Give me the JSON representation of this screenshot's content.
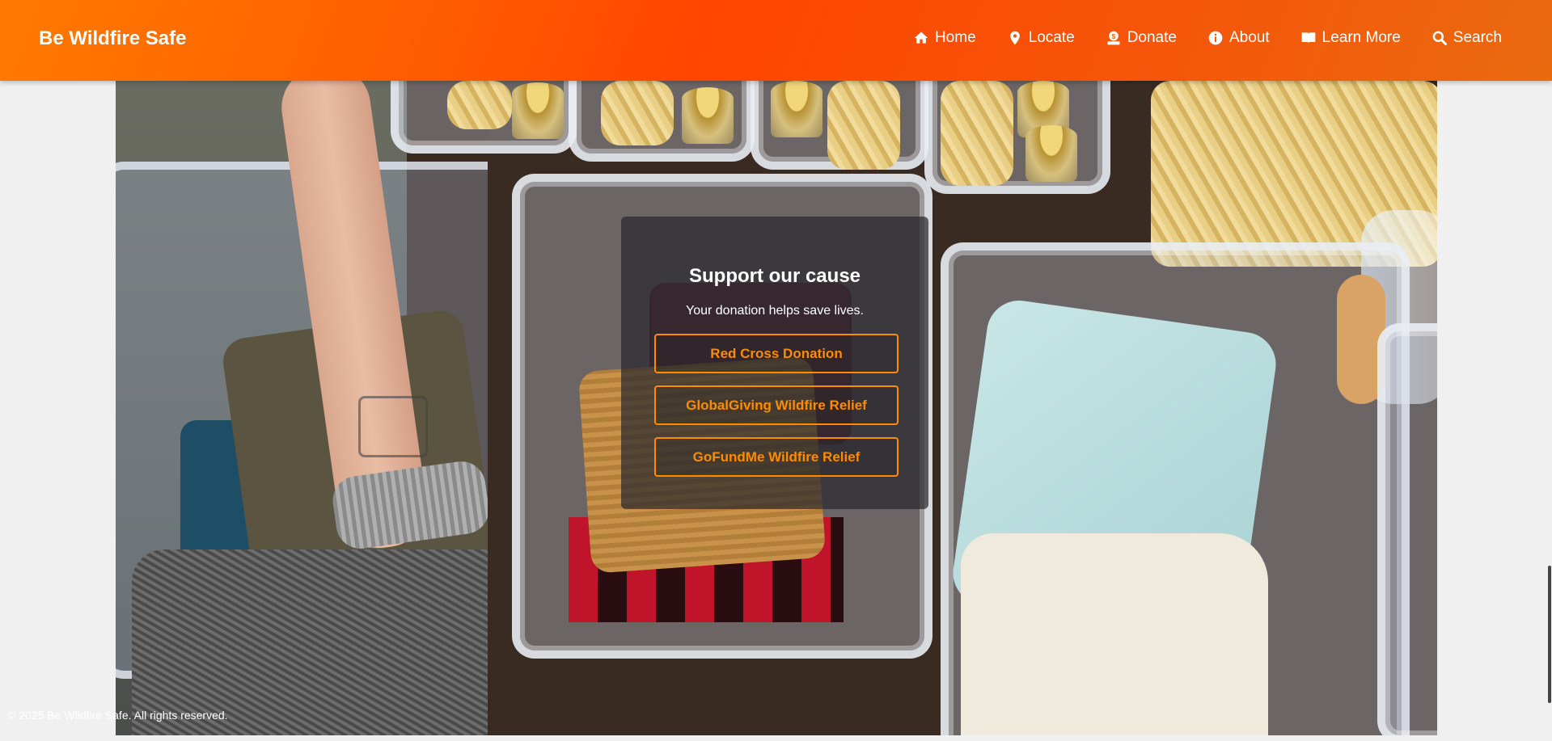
{
  "header": {
    "brand": "Be Wildfire Safe",
    "nav": [
      {
        "label": "Home",
        "icon": "home-icon"
      },
      {
        "label": "Locate",
        "icon": "map-pin-icon"
      },
      {
        "label": "Donate",
        "icon": "donate-icon"
      },
      {
        "label": "About",
        "icon": "info-icon"
      },
      {
        "label": "Learn More",
        "icon": "book-icon"
      },
      {
        "label": "Search",
        "icon": "search-icon"
      }
    ]
  },
  "donate_card": {
    "title": "Support our cause",
    "subtitle": "Your donation helps save lives.",
    "buttons": [
      "Red Cross Donation",
      "GlobalGiving Wildfire Relief",
      "GoFundMe Wildfire Relief"
    ]
  },
  "footer": {
    "text": "© 2025 Be Wildfire Safe. All rights reserved."
  },
  "colors": {
    "accent": "#ff8c00",
    "header_start": "#ff7a00",
    "header_end": "#ea6a10"
  }
}
